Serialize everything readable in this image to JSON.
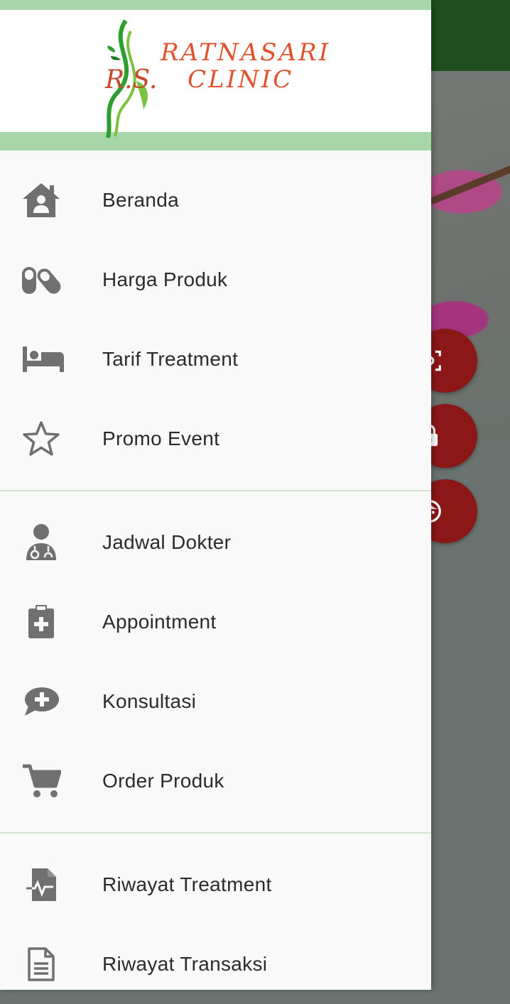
{
  "header": {
    "logo_line1": "RATNASARI",
    "logo_line2": "CLINIC",
    "logo_rs": "R.S."
  },
  "menu": {
    "section1": [
      {
        "label": "Beranda",
        "icon": "home-user-icon"
      },
      {
        "label": "Harga Produk",
        "icon": "pills-icon"
      },
      {
        "label": "Tarif Treatment",
        "icon": "bed-icon"
      },
      {
        "label": "Promo Event",
        "icon": "star-outline-icon"
      }
    ],
    "section2": [
      {
        "label": "Jadwal Dokter",
        "icon": "doctor-icon"
      },
      {
        "label": "Appointment",
        "icon": "clipboard-plus-icon"
      },
      {
        "label": "Konsultasi",
        "icon": "chat-plus-icon"
      },
      {
        "label": "Order Produk",
        "icon": "cart-icon"
      }
    ],
    "section3": [
      {
        "label": "Riwayat Treatment",
        "icon": "file-pulse-icon"
      },
      {
        "label": "Riwayat Transaksi",
        "icon": "document-icon"
      }
    ]
  },
  "background": {
    "fab_buttons": [
      "scan-face-icon",
      "lock-icon",
      "face-icon"
    ]
  },
  "colors": {
    "header_band": "#a7d7a8",
    "logo_text": "#e0532e",
    "icon_gray": "#707070",
    "fab_red": "#8b1717",
    "topbar_green": "#1f4e1e"
  }
}
